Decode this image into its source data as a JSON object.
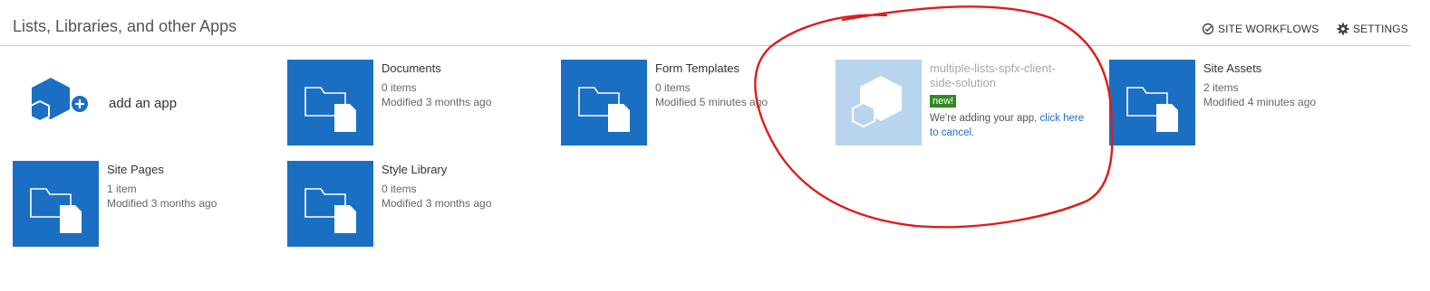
{
  "header": {
    "title": "Lists, Libraries, and other Apps",
    "site_workflows": "SITE WORKFLOWS",
    "settings": "SETTINGS"
  },
  "add_app": {
    "label": "add an app",
    "icon": "app-add-icon"
  },
  "tiles": [
    {
      "name": "Documents",
      "count": "0 items",
      "modified": "Modified 3 months ago"
    },
    {
      "name": "Form Templates",
      "count": "0 items",
      "modified": "Modified 5 minutes ago"
    },
    {
      "name": "Site Assets",
      "count": "2 items",
      "modified": "Modified 4 minutes ago"
    },
    {
      "name": "Site Pages",
      "count": "1 item",
      "modified": "Modified 3 months ago"
    },
    {
      "name": "Style Library",
      "count": "0 items",
      "modified": "Modified 3 months ago"
    }
  ],
  "pending_app": {
    "name_line1": "multiple-lists-spfx-client-",
    "name_line2": "side-solution",
    "badge": "new!",
    "message": "We're adding your app,",
    "link_line1": "click here",
    "link_line2": "to cancel."
  },
  "colors": {
    "tile": "#1a6fc2",
    "tile_pending": "#b9d5ee",
    "badge": "#2f8a1e",
    "annotation": "#e01b1b"
  }
}
